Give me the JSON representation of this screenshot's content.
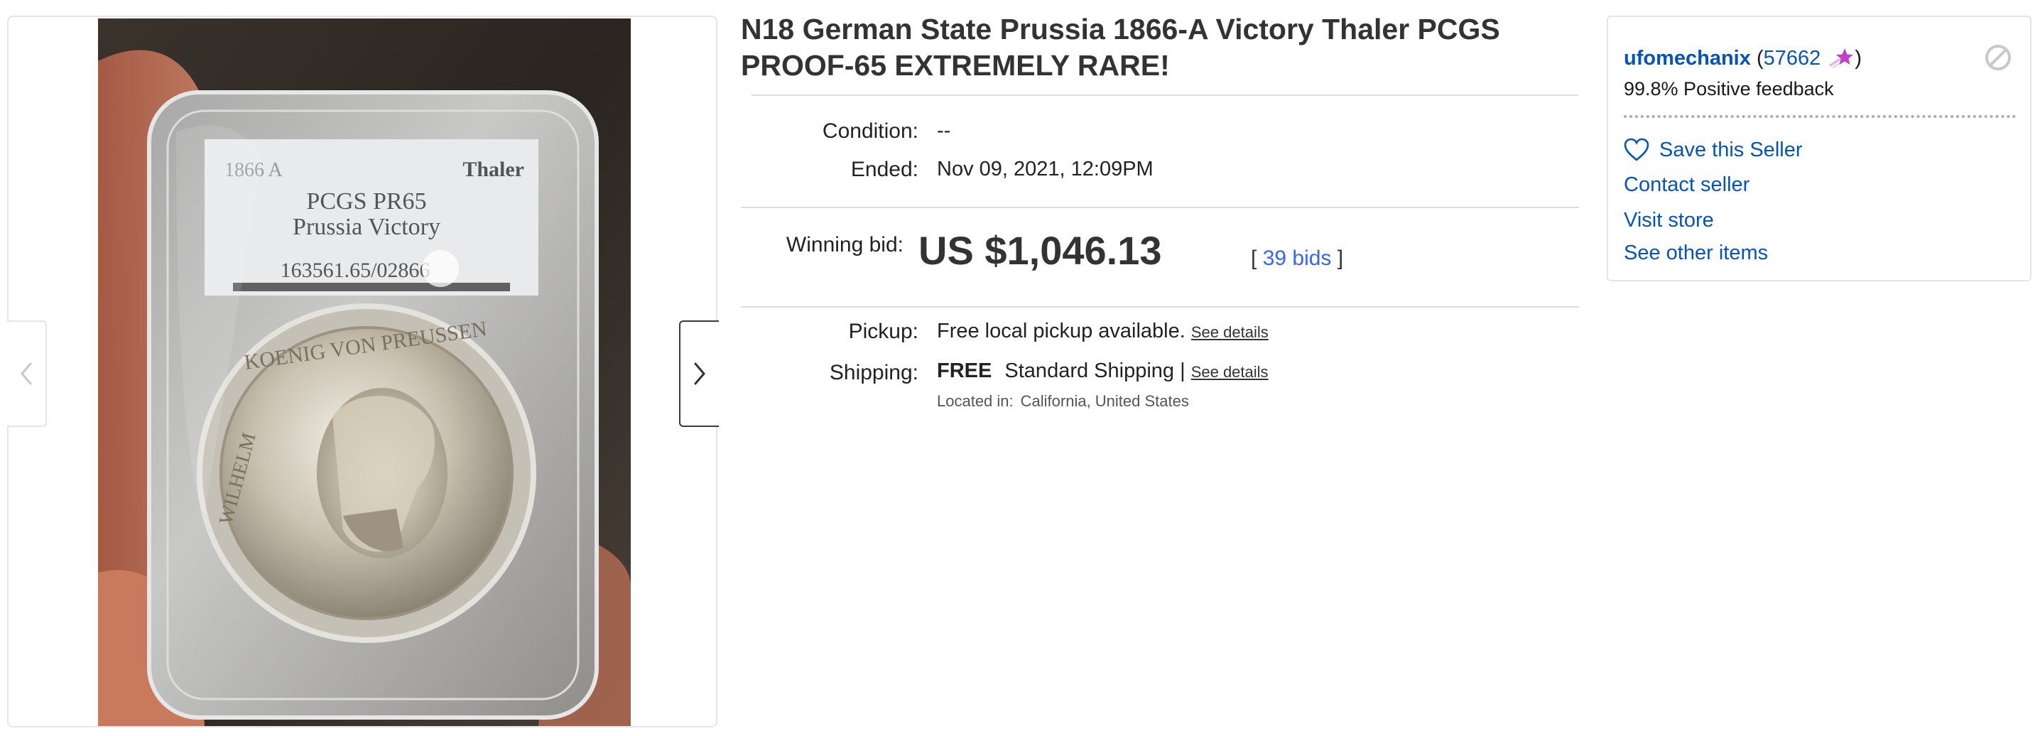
{
  "listing": {
    "title": "N18 German State Prussia 1866-A Victory Thaler PCGS PROOF-65 EXTREMELY RARE!",
    "condition_label": "Condition:",
    "condition_value": "--",
    "ended_label": "Ended:",
    "ended_value": "Nov 09, 2021, 12:09PM",
    "winning_bid_label": "Winning bid:",
    "winning_bid_value": "US $1,046.13",
    "bids_open": "[",
    "bids_link": "39 bids",
    "bids_close": "]",
    "pickup_label": "Pickup:",
    "pickup_value": "Free local pickup available.",
    "pickup_details": "See details",
    "shipping_label": "Shipping:",
    "shipping_free": "FREE",
    "shipping_value": "Standard Shipping |",
    "shipping_details": "See details",
    "located_label": "Located in:",
    "located_value": "California, United States"
  },
  "gallery": {
    "slab_label_left": "1866 A",
    "slab_label_right": "Thaler",
    "slab_grade": "PCGS PR65",
    "slab_name": "Prussia Victory",
    "slab_cert": "163561.65/02866",
    "coin_legend_top": "KOENIG VON PREUSSEN",
    "coin_legend_left": "WILHELM",
    "prev_icon": "chevron-left-icon",
    "next_icon": "chevron-right-icon"
  },
  "seller": {
    "name": "ufomechanix",
    "feedback_open": "(",
    "feedback_score": "57662",
    "feedback_close": ")",
    "star_icon": "purple-shooting-star-icon",
    "positive_feedback": "99.8% Positive feedback",
    "save_seller": "Save this Seller",
    "contact_seller": "Contact seller",
    "visit_store": "Visit store",
    "see_other_items": "See other items",
    "block_icon": "block-icon"
  },
  "colors": {
    "link_blue": "#0654ba",
    "bids_blue": "#3665f3",
    "star_purple": "#c042c9",
    "text_dark": "#333333"
  }
}
